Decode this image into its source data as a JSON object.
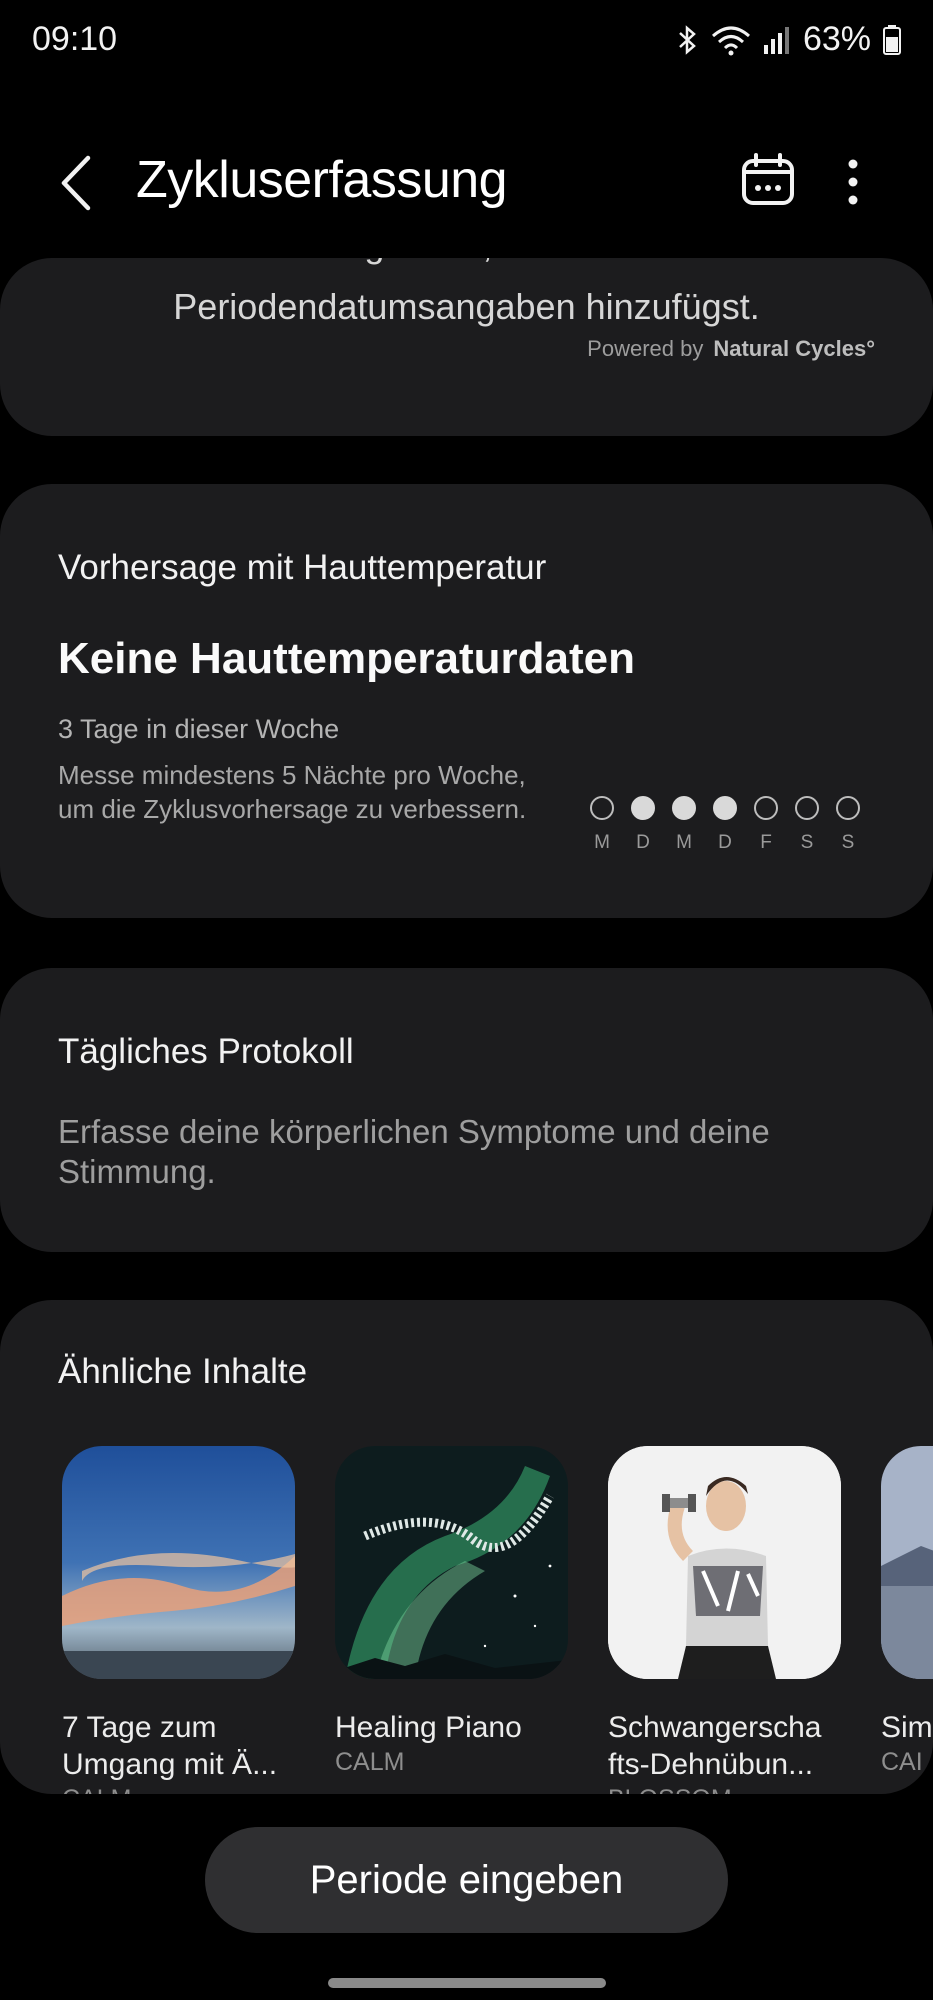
{
  "status_bar": {
    "time": "09:10",
    "battery": "63%"
  },
  "header": {
    "title": "Zykluserfassung"
  },
  "intro_card": {
    "line1": "Erhalte Prognosen, indem du deine",
    "line2": "Periodendatumsangaben hinzufügst.",
    "powered_by": "Powered by",
    "brand": "Natural Cycles°"
  },
  "temperature_card": {
    "section_title": "Vorhersage mit Hauttemperatur",
    "headline": "Keine Hauttemperaturdaten",
    "subline": "3 Tage in dieser Woche",
    "description": "Messe mindestens 5 Nächte pro Woche, um die Zyklusvorhersage zu verbessern.",
    "days": [
      {
        "label": "M",
        "measured": false
      },
      {
        "label": "D",
        "measured": true
      },
      {
        "label": "M",
        "measured": true
      },
      {
        "label": "D",
        "measured": true
      },
      {
        "label": "F",
        "measured": false
      },
      {
        "label": "S",
        "measured": false
      },
      {
        "label": "S",
        "measured": false
      }
    ]
  },
  "daily_log": {
    "title": "Tägliches Protokoll",
    "description": "Erfasse deine körperlichen Symptome und deine Stimmung."
  },
  "similar": {
    "title": "Ähnliche Inhalte",
    "items": [
      {
        "title": "7 Tage zum\nUmgang mit Ä...",
        "source": "CALM"
      },
      {
        "title": "Healing Piano",
        "source": "CALM"
      },
      {
        "title": "Schwangerscha\nfts-Dehnübun...",
        "source": "BLOSSOM"
      },
      {
        "title": "Sim",
        "source": "CAI"
      }
    ]
  },
  "cta": {
    "label": "Periode eingeben"
  }
}
